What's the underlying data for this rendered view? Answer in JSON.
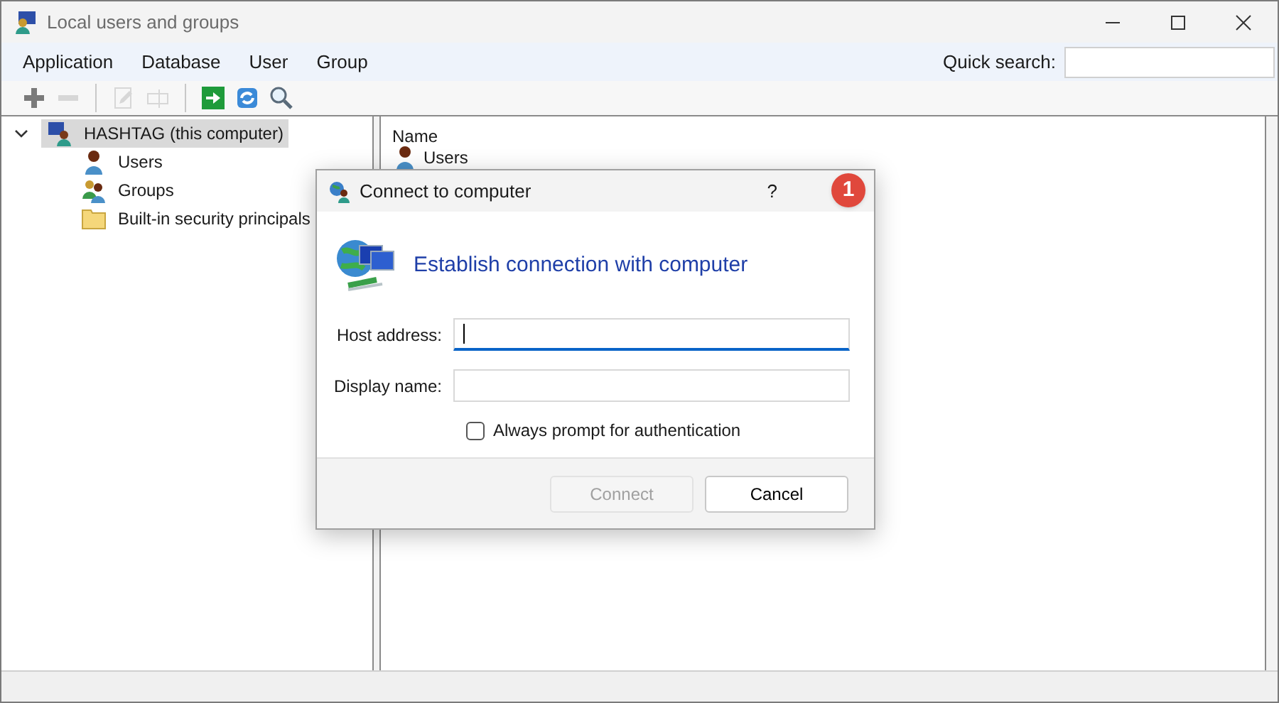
{
  "window": {
    "title": "Local users and groups"
  },
  "menu": [
    {
      "label": "Application"
    },
    {
      "label": "Database"
    },
    {
      "label": "User"
    },
    {
      "label": "Group"
    }
  ],
  "quick_search": {
    "label": "Quick search:"
  },
  "toolbar": [
    {
      "kind": "add",
      "disabled": false
    },
    {
      "kind": "remove",
      "disabled": true
    },
    {
      "kind": "sep"
    },
    {
      "kind": "edit",
      "disabled": true
    },
    {
      "kind": "rename",
      "disabled": true
    },
    {
      "kind": "sep"
    },
    {
      "kind": "connect",
      "disabled": false
    },
    {
      "kind": "refresh",
      "disabled": false
    },
    {
      "kind": "search",
      "disabled": false
    }
  ],
  "tree": [
    {
      "label": "HASHTAG (this computer)",
      "kind": "computer",
      "selected": true,
      "expanded": true,
      "children": [
        {
          "label": "Users",
          "kind": "user",
          "selected": false
        },
        {
          "label": "Groups",
          "kind": "group",
          "selected": false
        },
        {
          "label": "Built-in security principals",
          "kind": "folder",
          "selected": false
        }
      ]
    }
  ],
  "list": {
    "column": "Name",
    "rows": [
      {
        "label": "Users"
      }
    ]
  },
  "dialog": {
    "title": "Connect to computer",
    "help": "?",
    "heading": "Establish connection with computer",
    "fields": [
      {
        "label": "Host address:",
        "focused": true
      },
      {
        "label": "Display name:",
        "focused": false
      }
    ],
    "checkbox": {
      "label": "Always prompt for authentication",
      "checked": false
    },
    "buttons": [
      {
        "label": "Connect",
        "disabled": true
      },
      {
        "label": "Cancel",
        "disabled": false
      }
    ]
  },
  "annotation": {
    "label": "1"
  }
}
